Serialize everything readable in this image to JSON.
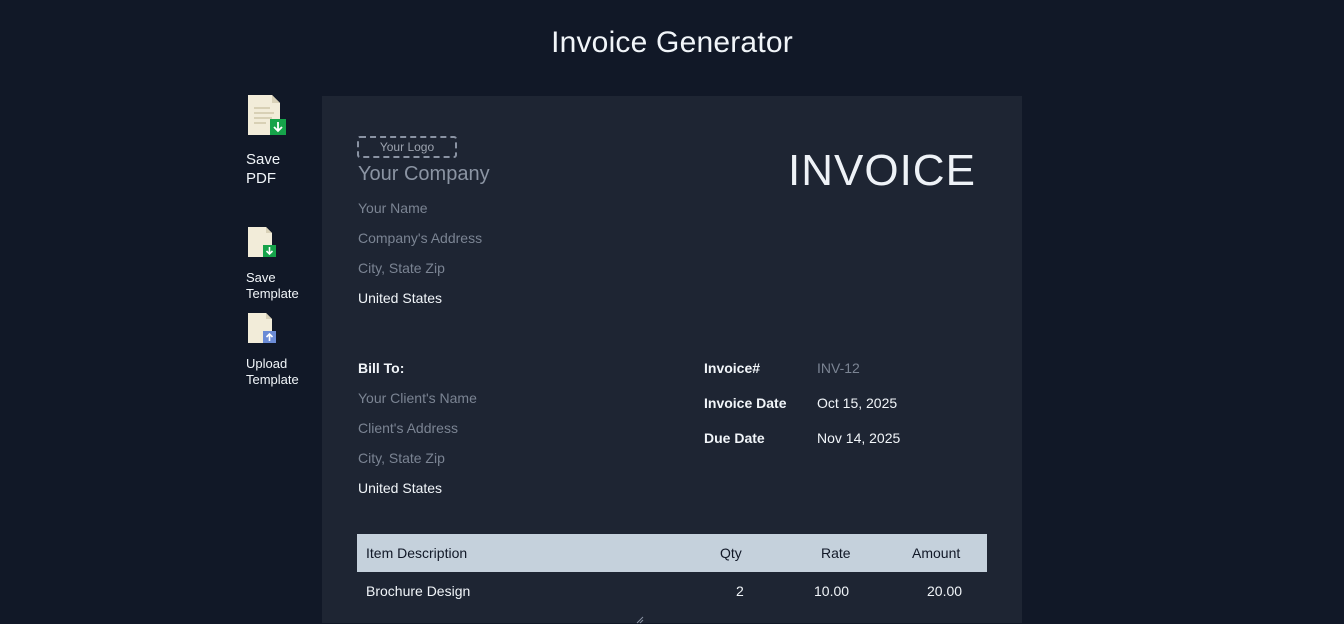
{
  "page": {
    "title": "Invoice Generator"
  },
  "sidebar": {
    "save_pdf": "Save\nPDF",
    "save_template": "Save\nTemplate",
    "upload_template": "Upload\nTemplate"
  },
  "invoice": {
    "logo_placeholder": "Your Logo",
    "heading": "INVOICE",
    "from": {
      "company": "Your Company",
      "name": "Your Name",
      "address": "Company's Address",
      "city": "City, State Zip",
      "country": "United States"
    },
    "bill_to": {
      "label": "Bill To:",
      "client_name": "Your Client's Name",
      "address": "Client's Address",
      "city": "City, State Zip",
      "country": "United States"
    },
    "meta": {
      "invoice_no_label": "Invoice#",
      "invoice_no": "INV-12",
      "invoice_date_label": "Invoice Date",
      "invoice_date": "Oct 15, 2025",
      "due_date_label": "Due Date",
      "due_date": "Nov 14, 2025"
    },
    "table": {
      "headers": {
        "description": "Item Description",
        "qty": "Qty",
        "rate": "Rate",
        "amount": "Amount"
      },
      "rows": [
        {
          "description": "Brochure Design",
          "qty": "2",
          "rate": "10.00",
          "amount": "20.00"
        }
      ]
    }
  },
  "colors": {
    "background": "#111827",
    "panel": "#1e2533",
    "table_header": "#c5d1dc",
    "download_green": "#16a34a",
    "upload_blue": "#6b8bd6"
  },
  "icons": {
    "save_pdf": "document-download-icon",
    "save_template": "document-download-icon",
    "upload_template": "document-upload-icon"
  }
}
